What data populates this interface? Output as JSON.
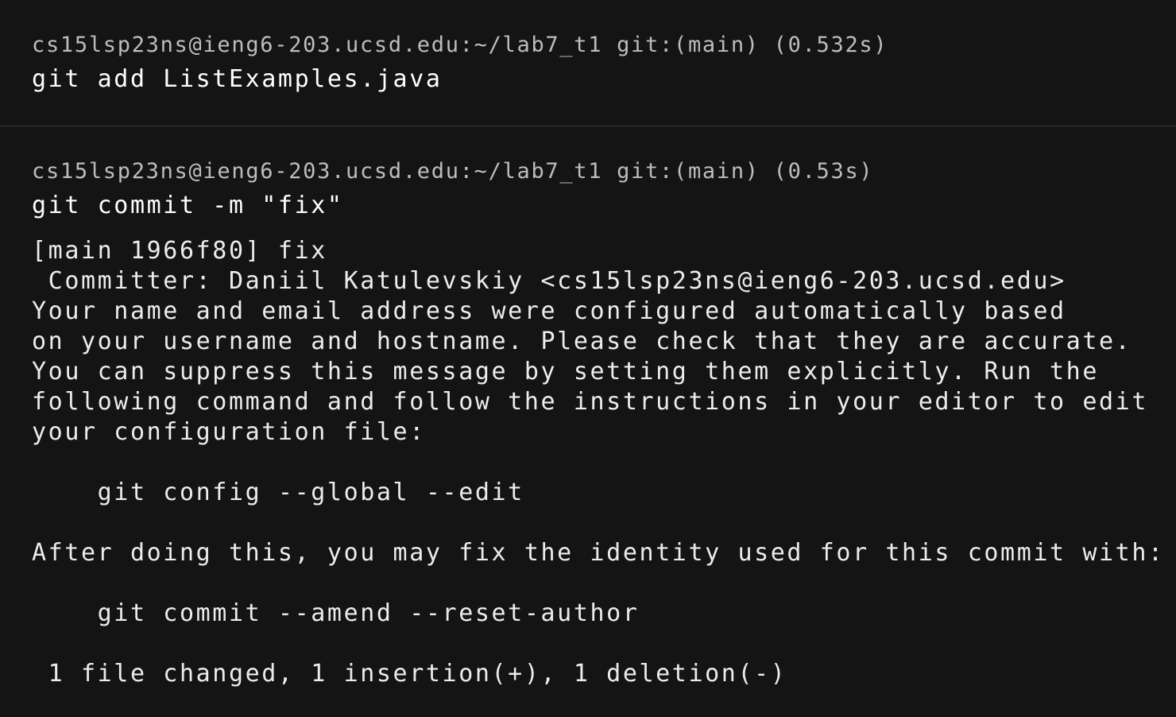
{
  "blocks": [
    {
      "prompt": "cs15lsp23ns@ieng6-203.ucsd.edu:~/lab7_t1 git:(main) (0.532s)",
      "command": "git add ListExamples.java",
      "output": []
    },
    {
      "prompt": "cs15lsp23ns@ieng6-203.ucsd.edu:~/lab7_t1 git:(main) (0.53s)",
      "command": "git commit -m \"fix\"",
      "output": [
        "[main 1966f80] fix",
        " Committer: Daniil Katulevskiy <cs15lsp23ns@ieng6-203.ucsd.edu>",
        "Your name and email address were configured automatically based",
        "on your username and hostname. Please check that they are accurate.",
        "You can suppress this message by setting them explicitly. Run the",
        "following command and follow the instructions in your editor to edit",
        "your configuration file:",
        "",
        "    git config --global --edit",
        "",
        "After doing this, you may fix the identity used for this commit with:",
        "",
        "    git commit --amend --reset-author",
        "",
        " 1 file changed, 1 insertion(+), 1 deletion(-)"
      ]
    }
  ]
}
